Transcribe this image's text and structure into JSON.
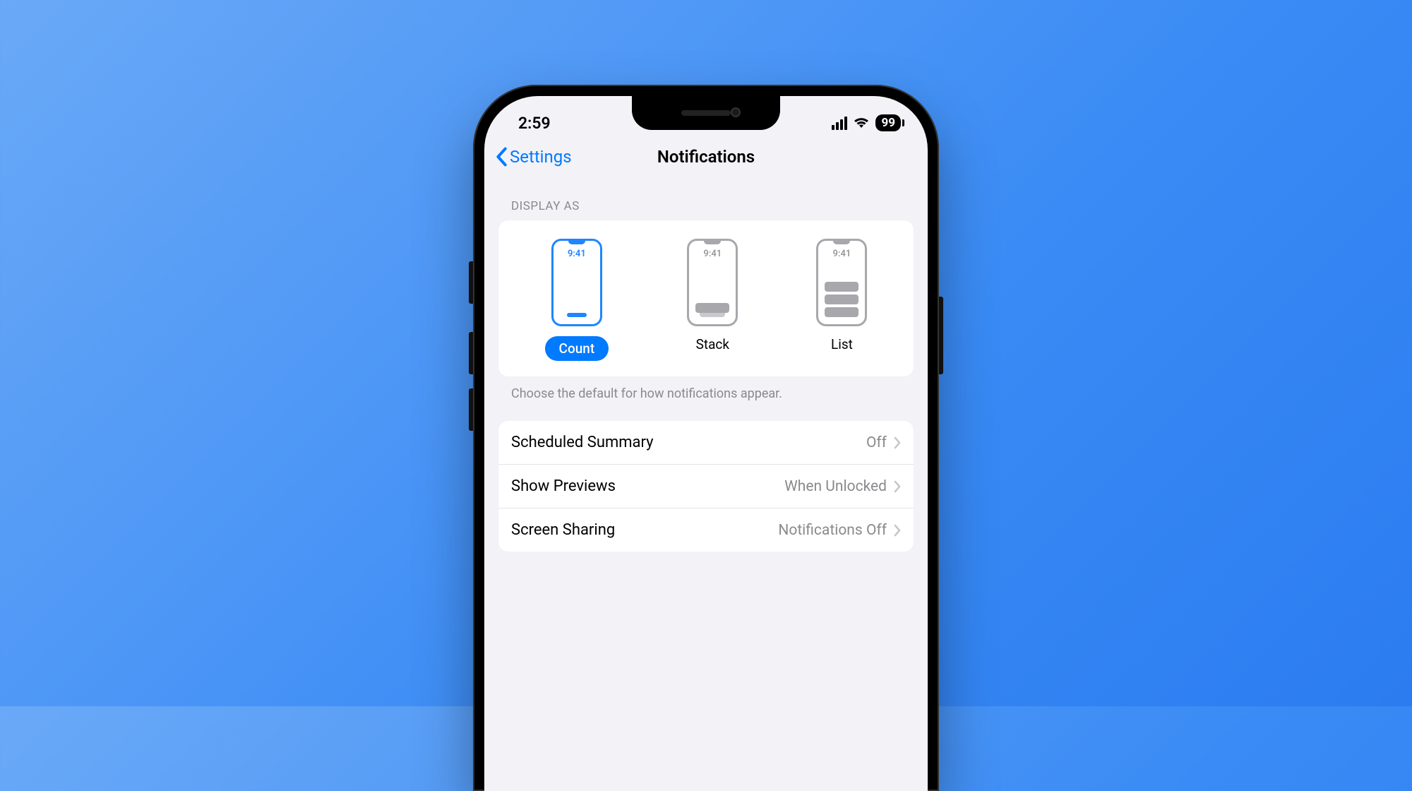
{
  "statusBar": {
    "time": "2:59",
    "batteryPercent": "99"
  },
  "nav": {
    "backLabel": "Settings",
    "title": "Notifications"
  },
  "displayAs": {
    "header": "DISPLAY AS",
    "miniTime": "9:41",
    "options": [
      {
        "label": "Count",
        "selected": true
      },
      {
        "label": "Stack",
        "selected": false
      },
      {
        "label": "List",
        "selected": false
      }
    ],
    "footer": "Choose the default for how notifications appear."
  },
  "rows": [
    {
      "label": "Scheduled Summary",
      "value": "Off"
    },
    {
      "label": "Show Previews",
      "value": "When Unlocked"
    },
    {
      "label": "Screen Sharing",
      "value": "Notifications Off"
    }
  ]
}
